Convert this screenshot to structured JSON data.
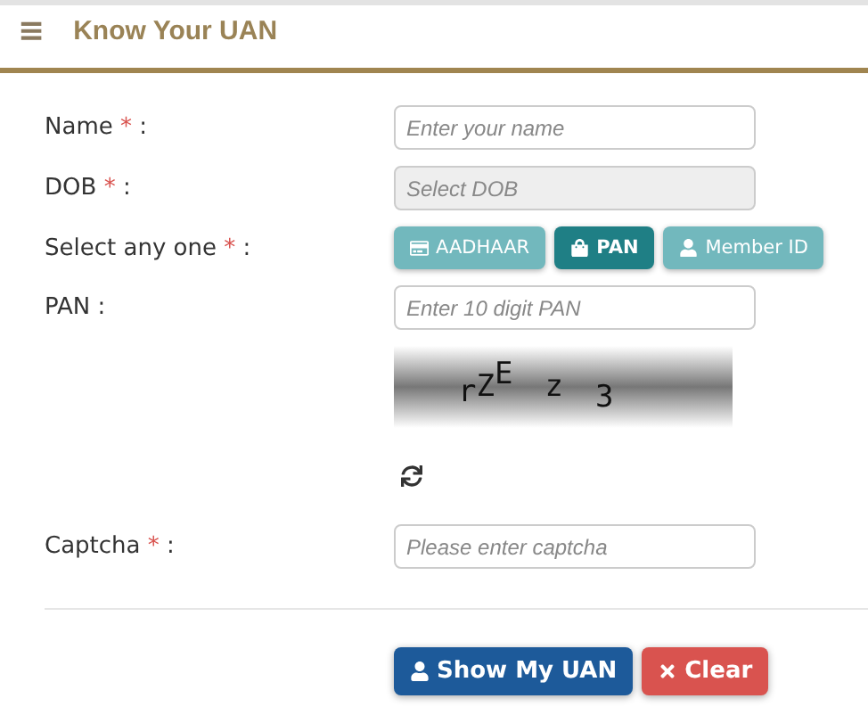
{
  "header": {
    "menu_icon": "≡",
    "title": "Know Your UAN"
  },
  "fields": [
    {
      "label": "Name",
      "required_mark": "*",
      "colon": ":",
      "placeholder": "Enter your name",
      "disabled": false
    },
    {
      "label": "DOB",
      "required_mark": "*",
      "colon": ":",
      "placeholder": "Select DOB",
      "disabled": true
    }
  ],
  "id_choice": {
    "label": "Select any one",
    "required_mark": "*",
    "colon": ":",
    "options": [
      {
        "label": "AADHAAR",
        "kind": "card",
        "selected": false
      },
      {
        "label": "PAN",
        "kind": "bag",
        "selected": true
      },
      {
        "label": "Member ID",
        "kind": "user",
        "selected": false
      }
    ]
  },
  "pan_field": {
    "label": "PAN :",
    "placeholder": "Enter 10 digit PAN"
  },
  "captcha_image": {
    "chars": [
      "r",
      "Z",
      "E",
      "z",
      "3"
    ]
  },
  "captcha_field": {
    "label": "Captcha",
    "required_mark": "*",
    "colon": ":",
    "placeholder": "Please enter captcha"
  },
  "buttons": [
    {
      "label": "Show My UAN",
      "kind": "primary"
    },
    {
      "label": "Clear",
      "kind": "danger"
    }
  ]
}
